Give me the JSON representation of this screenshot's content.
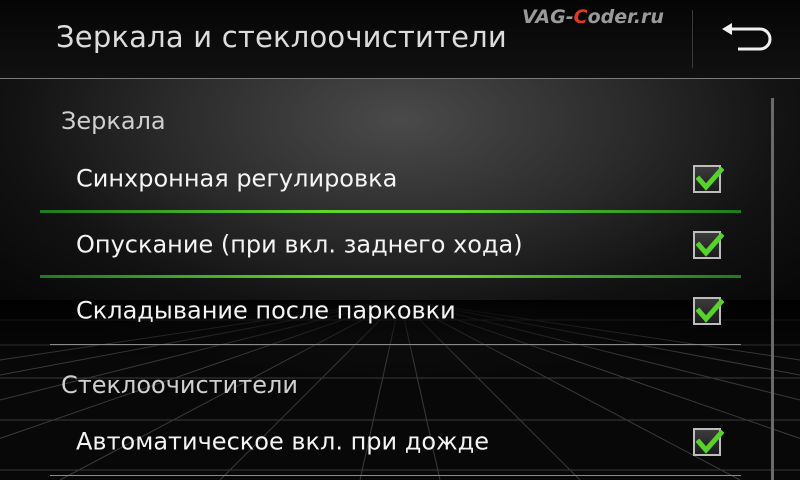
{
  "header": {
    "title": "Зеркала и стеклоочистители",
    "back_icon": "back-arrow-icon"
  },
  "watermark": {
    "part1": "VAG-",
    "part2": "C",
    "part3": "oder.ru"
  },
  "sections": [
    {
      "label": "Зеркала",
      "items": [
        {
          "label": "Синхронная регулировка",
          "checked": true
        },
        {
          "label": "Опускание (при вкл. заднего хода)",
          "checked": true
        },
        {
          "label": "Складывание после парковки",
          "checked": true
        }
      ]
    },
    {
      "label": "Стеклоочистители",
      "items": [
        {
          "label": "Автоматическое вкл. при дожде",
          "checked": true
        }
      ]
    }
  ],
  "colors": {
    "check_green": "#56d22a",
    "selection_green": "#5fd42a",
    "watermark_accent": "#e03a1e"
  }
}
